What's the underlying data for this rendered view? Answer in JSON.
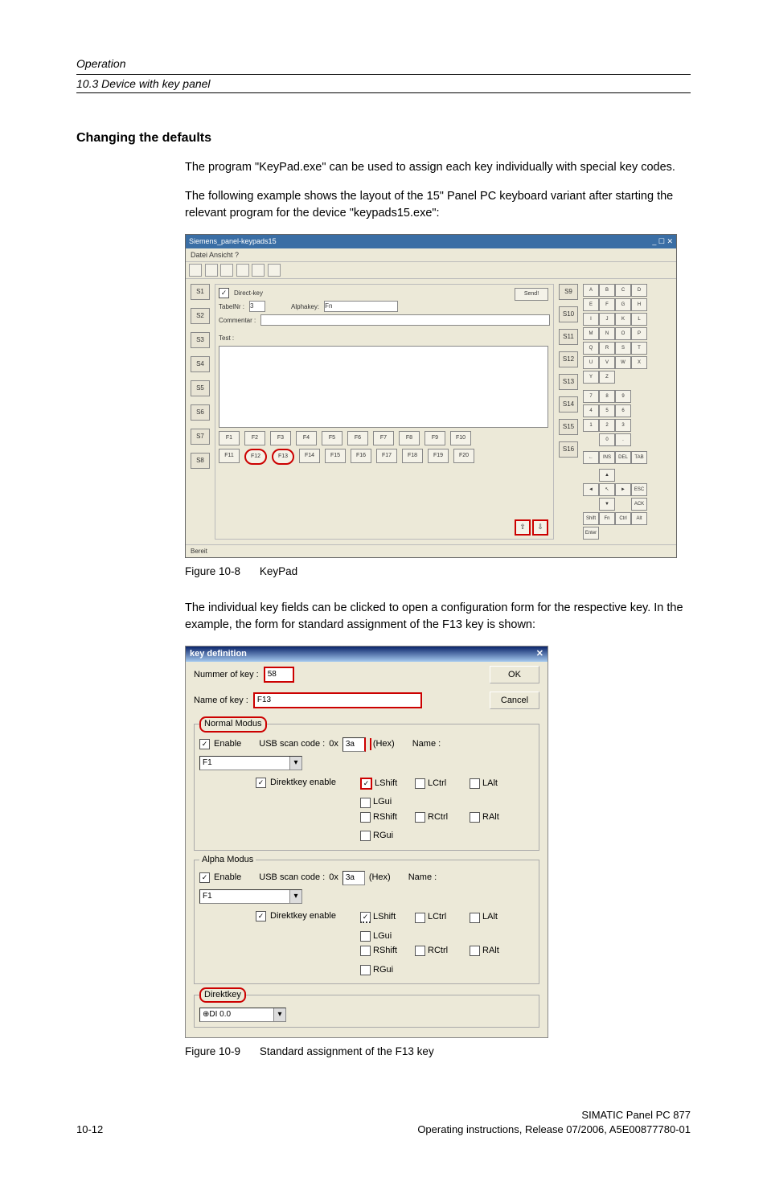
{
  "header": {
    "chapter": "Operation",
    "section": "10.3 Device with key panel"
  },
  "heading": "Changing the defaults",
  "p1": "The program \"KeyPad.exe\" can be used to assign each key individually with special key codes.",
  "p2": "The following example shows the layout of the 15\" Panel PC keyboard variant after starting the relevant program for the device \"keypads15.exe\":",
  "fig1": {
    "num": "Figure 10-8",
    "caption": "KeyPad",
    "window_title": "Siemens_panel-keypads15",
    "menu": "Datei   Ansicht   ?",
    "status": "Bereit",
    "send": "Send!",
    "s_left": [
      "S1",
      "S2",
      "S3",
      "S4",
      "S5",
      "S6",
      "S7",
      "S8"
    ],
    "s_right": [
      "S9",
      "S10",
      "S11",
      "S12",
      "S13",
      "S14",
      "S15",
      "S16"
    ],
    "form": {
      "chk_label": "Direct-key",
      "table_label": "TabelNr :",
      "table_val": "3",
      "alpha_label": "Alphakey:",
      "alpha_val": "Fn",
      "comment_label": "Commentar :",
      "test_label": "Test :"
    },
    "f_top": [
      "F1",
      "F2",
      "F3",
      "F4",
      "F5",
      "F6",
      "F7",
      "F8",
      "F9",
      "F10"
    ],
    "f_bot": [
      "F11",
      "F12",
      "F13",
      "F14",
      "F15",
      "F16",
      "F17",
      "F18",
      "F19",
      "F20"
    ],
    "grid1": [
      "A",
      "B",
      "C",
      "D",
      "E",
      "F",
      "G",
      "H",
      "I",
      "J",
      "K",
      "L",
      "M",
      "N",
      "O",
      "P",
      "Q",
      "R",
      "S",
      "T",
      "U",
      "V",
      "W",
      "X",
      "Y",
      "Z",
      "",
      ""
    ],
    "grid2": [
      "7",
      "8",
      "9",
      "",
      "4",
      "5",
      "6",
      "",
      "1",
      "2",
      "3",
      "",
      "",
      "0",
      ".",
      ""
    ],
    "grid3": [
      "←",
      "INS",
      "DEL",
      "TAB"
    ],
    "nav": [
      "",
      "▲",
      "",
      "",
      "◄",
      "↖",
      "►",
      "ESC",
      "",
      "▼",
      "",
      "ACK",
      "Shift",
      "Fn",
      "Ctrl",
      "Alt",
      "Enter"
    ]
  },
  "p3": "The individual key fields can be clicked to open a configuration form for the respective key. In the example, the form for standard assignment of the F13 key is shown:",
  "fig2": {
    "num": "Figure 10-9",
    "caption": "Standard assignment of the F13 key",
    "title": "key definition",
    "num_label": "Nummer of key :",
    "num_val": "58",
    "name_label": "Name of key :",
    "name_val": "F13",
    "ok": "OK",
    "cancel": "Cancel",
    "legend_normal": "Normal Modus",
    "legend_alpha": "Alpha Modus",
    "legend_direct": "Direktkey",
    "enable": "Enable",
    "scan_label": "USB scan code :",
    "scan_prefix": "0x",
    "scan_val": "3a",
    "scan_suffix": "(Hex)",
    "name_lbl": "Name :",
    "name_sel": "F1",
    "dk_enable": "Direktkey enable",
    "mods": [
      "LShift",
      "LCtrl",
      "LAlt",
      "LGui",
      "RShift",
      "RCtrl",
      "RAlt",
      "RGui"
    ],
    "direct_val": "⊕DI 0.0"
  },
  "footer": {
    "page": "10-12",
    "product": "SIMATIC Panel PC 877",
    "doc": "Operating instructions, Release 07/2006, A5E00877780-01"
  }
}
